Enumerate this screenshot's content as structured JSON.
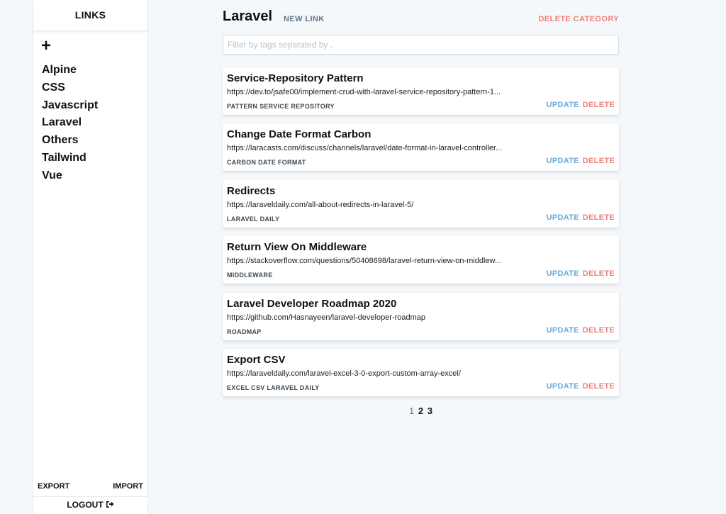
{
  "sidebar": {
    "title": "LINKS",
    "add_label": "+",
    "categories": [
      "Alpine",
      "CSS",
      "Javascript",
      "Laravel",
      "Others",
      "Tailwind",
      "Vue"
    ],
    "export_label": "EXPORT",
    "import_label": "IMPORT",
    "logout_label": "LOGOUT",
    "logout_icon": "sign-out-icon"
  },
  "header": {
    "title": "Laravel",
    "new_link_label": "NEW LINK",
    "delete_category_label": "DELETE CATEGORY"
  },
  "filter": {
    "placeholder": "Filter by tags separated by ,",
    "value": ""
  },
  "links": [
    {
      "title": "Service-Repository Pattern",
      "url": "https://dev.to/jsafe00/implement-crud-with-laravel-service-repository-pattern-1...",
      "tags": "PATTERN SERVICE REPOSITORY",
      "update_label": "UPDATE",
      "delete_label": "DELETE"
    },
    {
      "title": "Change Date Format Carbon",
      "url": "https://laracasts.com/discuss/channels/laravel/date-format-in-laravel-controller...",
      "tags": "CARBON DATE FORMAT",
      "update_label": "UPDATE",
      "delete_label": "DELETE"
    },
    {
      "title": "Redirects",
      "url": "https://laraveldaily.com/all-about-redirects-in-laravel-5/",
      "tags": "LARAVEL DAILY",
      "update_label": "UPDATE",
      "delete_label": "DELETE"
    },
    {
      "title": "Return View On Middleware",
      "url": "https://stackoverflow.com/questions/50408698/laravel-return-view-on-middlew...",
      "tags": "MIDDLEWARE",
      "update_label": "UPDATE",
      "delete_label": "DELETE"
    },
    {
      "title": "Laravel Developer Roadmap 2020",
      "url": "https://github.com/Hasnayeen/laravel-developer-roadmap",
      "tags": "ROADMAP",
      "update_label": "UPDATE",
      "delete_label": "DELETE"
    },
    {
      "title": "Export CSV",
      "url": "https://laraveldaily.com/laravel-excel-3-0-export-custom-array-excel/",
      "tags": "EXCEL CSV LARAVEL DAILY",
      "update_label": "UPDATE",
      "delete_label": "DELETE"
    }
  ],
  "pagination": {
    "pages": [
      "1",
      "2",
      "3"
    ],
    "current": "1"
  },
  "colors": {
    "accent_update": "#6aa9d4",
    "accent_delete": "#ef7f7a",
    "muted": "#5f7488",
    "background": "#f5f8fb"
  }
}
